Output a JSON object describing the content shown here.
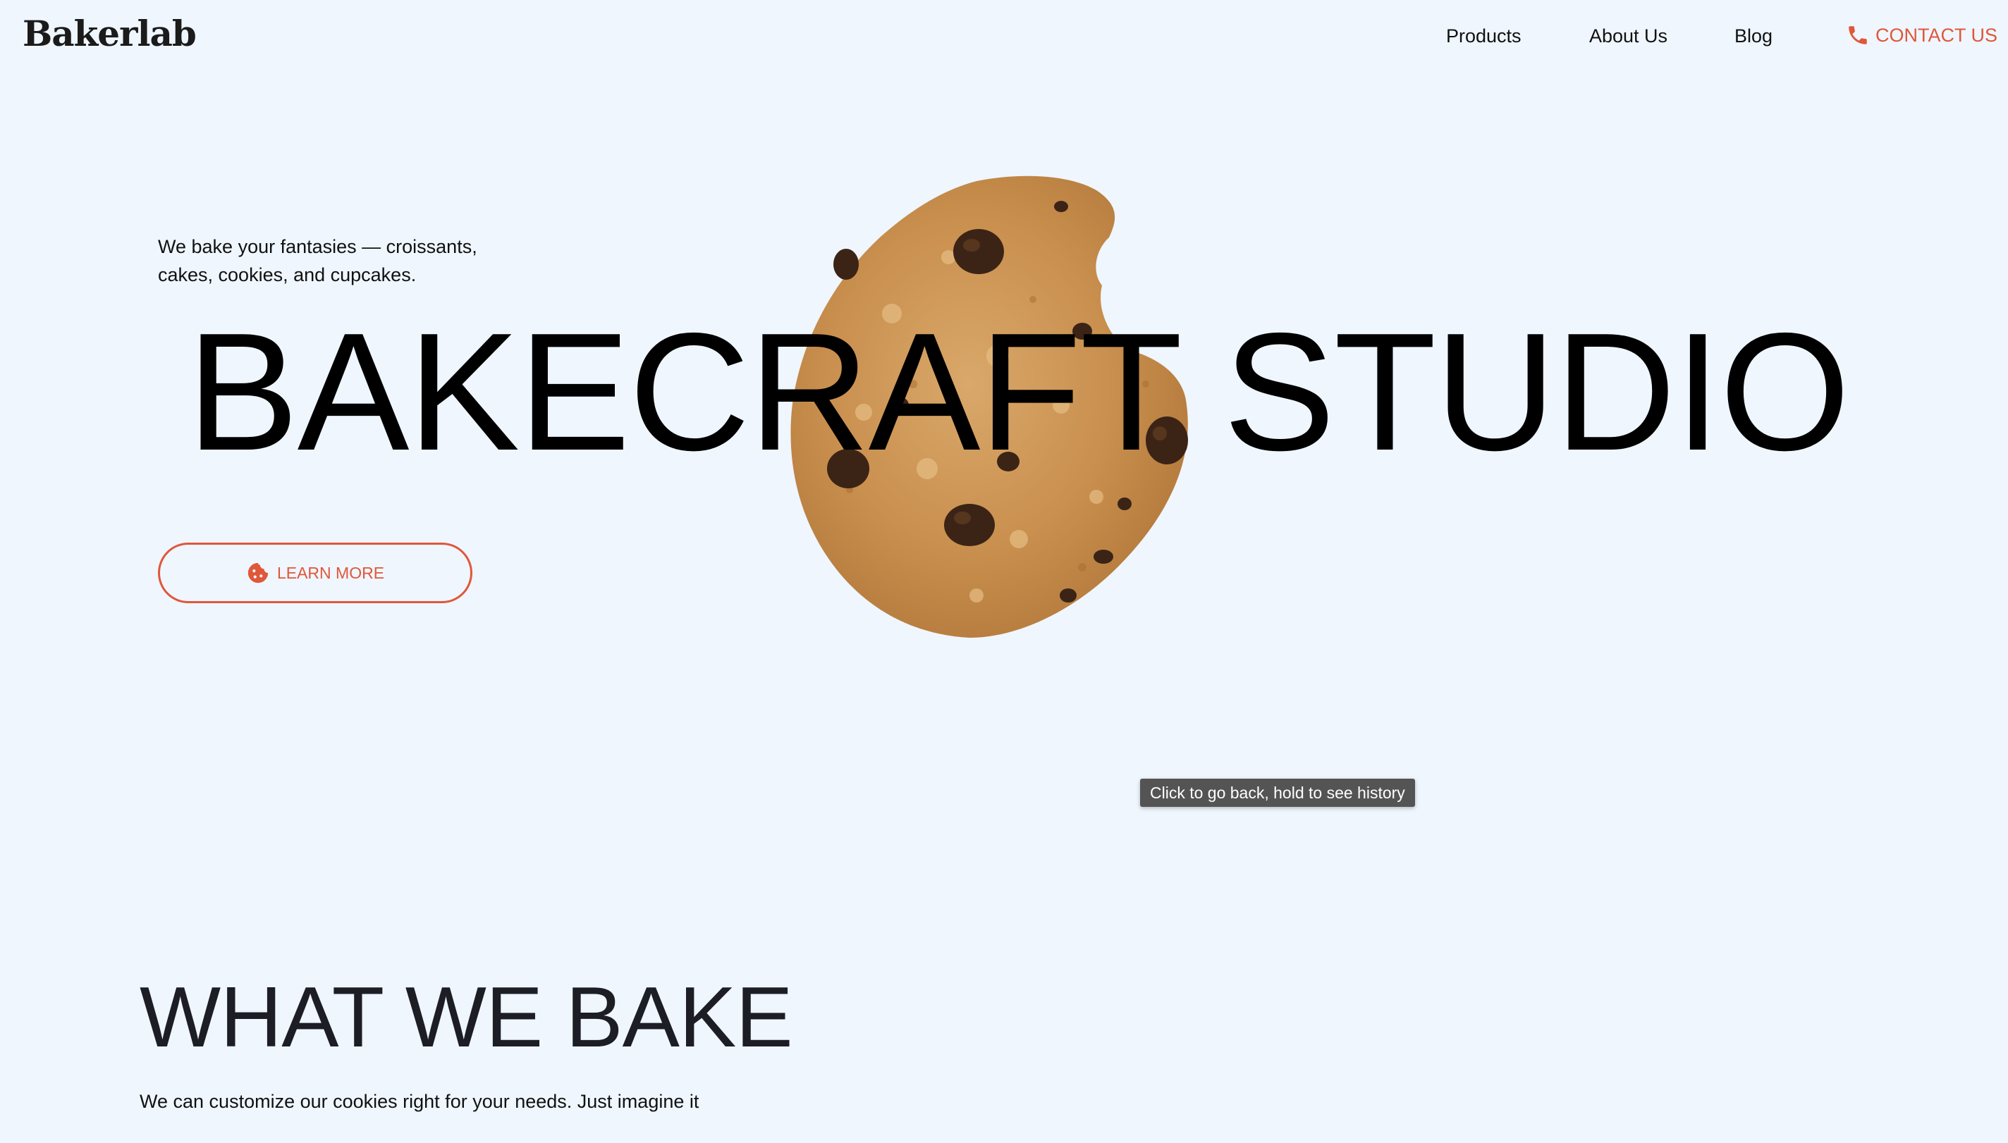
{
  "header": {
    "logo": "Bakerlab",
    "nav": {
      "products": "Products",
      "about": "About Us",
      "blog": "Blog",
      "contact": "CONTACT US",
      "contact_icon": "phone-icon"
    }
  },
  "hero": {
    "tagline": "We bake your fantasies — croissants, cakes, cookies, and cupcakes.",
    "title": "BAKECRAFT STUDIO",
    "image": "chocolate-chip-cookie",
    "cta": {
      "label": "LEARN MORE",
      "icon": "cookie-icon"
    }
  },
  "tooltip": "Click to go back, hold to see history",
  "section": {
    "title": "WHAT WE BAKE",
    "subtitle": "We can customize our cookies right for your needs. Just imagine it"
  },
  "colors": {
    "background": "#eff6fe",
    "accent": "#e0573a",
    "text": "#111111",
    "tooltip_bg": "#545454"
  }
}
